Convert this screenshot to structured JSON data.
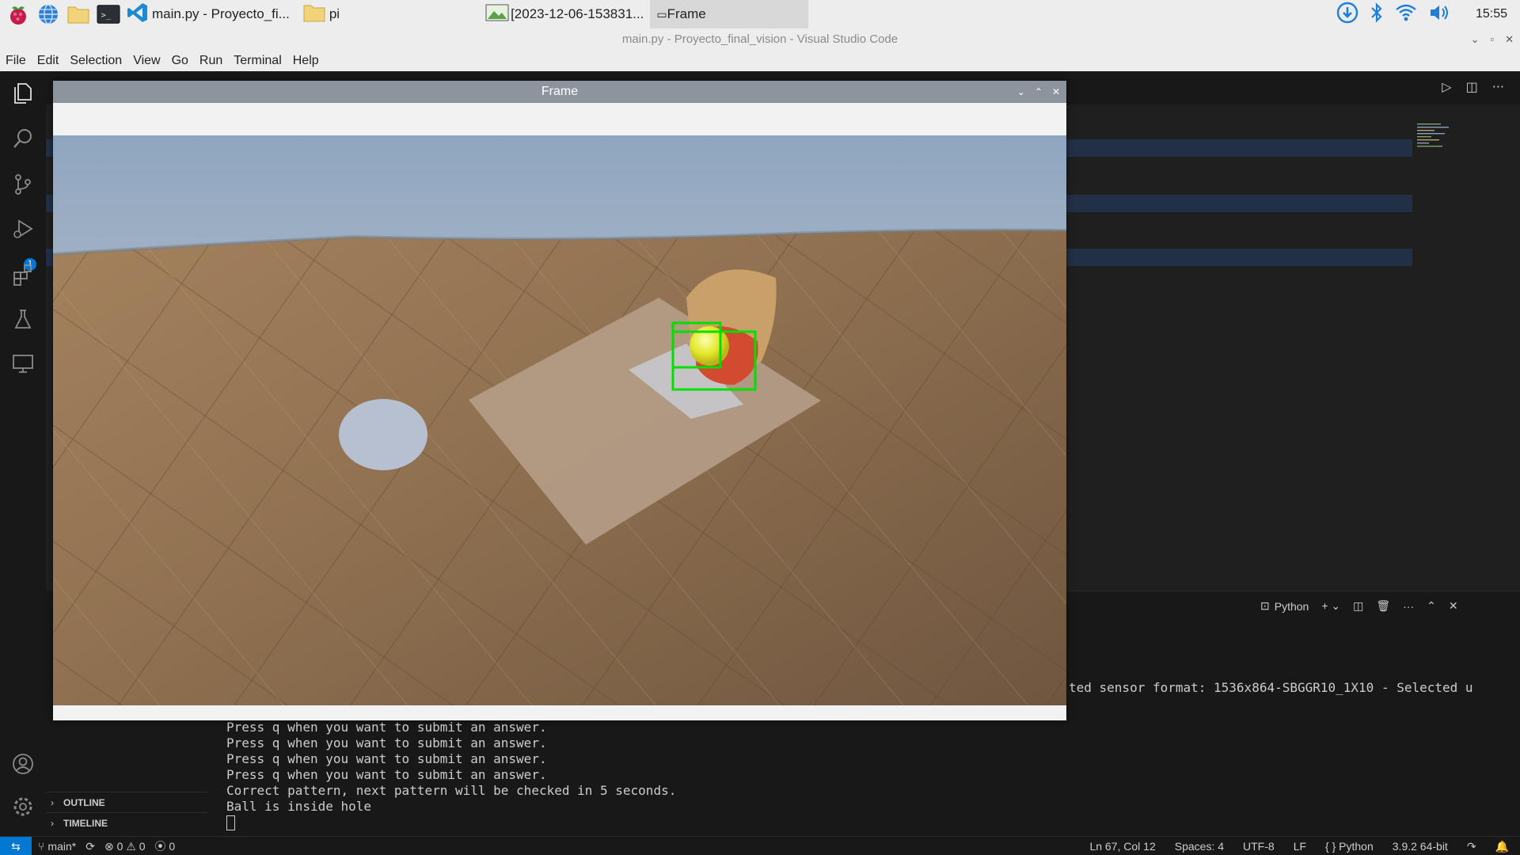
{
  "taskbar": {
    "tasks": [
      {
        "label": "main.py - Proyecto_fi..."
      },
      {
        "label": "pi"
      },
      {
        "label": "[2023-12-06-153831..."
      },
      {
        "label": "Frame"
      }
    ],
    "clock": "15:55"
  },
  "window": {
    "title": "main.py - Proyecto_final_vision - Visual Studio Code"
  },
  "menu": [
    "File",
    "Edit",
    "Selection",
    "View",
    "Go",
    "Run",
    "Terminal",
    "Help"
  ],
  "activity": {
    "source_control_badge": "1"
  },
  "frame_window": {
    "title": "Frame"
  },
  "panel": {
    "shell_label": "Python",
    "terminal_right_text": "ted sensor format: 1536x864-SBGGR10_1X10 - Selected u",
    "terminal_lines": [
      "Press q when you want to submit an answer.",
      "Press q when you want to submit an answer.",
      "Press q when you want to submit an answer.",
      "Press q when you want to submit an answer.",
      "Correct pattern, next pattern will be checked in 5 seconds.",
      "Ball is inside hole"
    ]
  },
  "sidebar": {
    "outline_label": "OUTLINE",
    "timeline_label": "TIMELINE"
  },
  "statusbar": {
    "branch": "main*",
    "errors": "0",
    "warnings": "0",
    "ports": "0",
    "position": "Ln 67, Col 12",
    "spaces": "Spaces: 4",
    "encoding": "UTF-8",
    "eol": "LF",
    "language": "Python",
    "interpreter": "3.9.2 64-bit"
  },
  "colors": {
    "accent": "#0078d4",
    "detection_box": "#00e000"
  }
}
